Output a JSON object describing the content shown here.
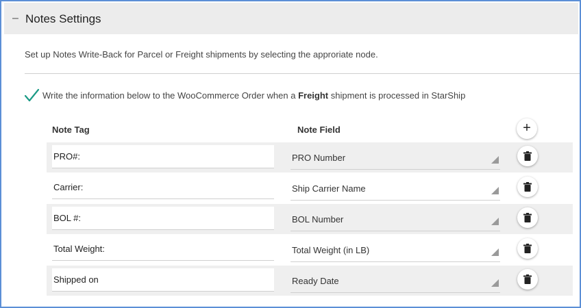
{
  "panel": {
    "toggle_symbol": "–",
    "title": "Notes Settings"
  },
  "description": "Set up Notes Write-Back for Parcel or Freight shipments by selecting the approriate node.",
  "checkbox": {
    "checked": true,
    "label_before": "Write the information below to the WooCommerce Order when a ",
    "label_bold": "Freight",
    "label_after": " shipment is processed in StarShip"
  },
  "table": {
    "columns": {
      "tag": "Note Tag",
      "field": "Note Field"
    },
    "add_symbol": "+",
    "rows": [
      {
        "tag": "PRO#:",
        "field": "PRO Number"
      },
      {
        "tag": "Carrier:",
        "field": "Ship Carrier Name"
      },
      {
        "tag": "BOL #:",
        "field": "BOL Number"
      },
      {
        "tag": "Total Weight:",
        "field": "Total Weight (in LB)"
      },
      {
        "tag": "Shipped on",
        "field": "Ready Date"
      }
    ]
  },
  "colors": {
    "frame_border": "#5b8fd6",
    "check_accent": "#1a9a85",
    "header_bg": "#ececec",
    "row_shade": "#efefef"
  }
}
